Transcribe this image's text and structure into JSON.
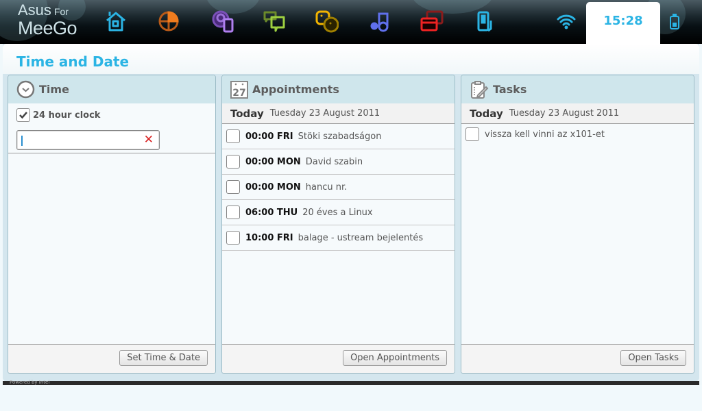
{
  "topbar": {
    "logo_line1": "Asus",
    "logo_line1_small": "For",
    "logo_line2": "MeeGo",
    "apps": [
      {
        "name": "home",
        "color": "#2bb4e4"
      },
      {
        "name": "applications",
        "color": "#e07020"
      },
      {
        "name": "people",
        "color": "#9060d0"
      },
      {
        "name": "status",
        "color": "#8cc63f"
      },
      {
        "name": "friends",
        "color": "#f0b400"
      },
      {
        "name": "media",
        "color": "#5a6ee8"
      },
      {
        "name": "windows",
        "color": "#e02020"
      },
      {
        "name": "device",
        "color": "#2bb4e4"
      }
    ],
    "clock": "15:28",
    "wifi_icon": "wifi-icon",
    "battery_icon": "battery-icon"
  },
  "page": {
    "title": "Time and Date"
  },
  "time_panel": {
    "title": "Time",
    "checkbox_label": "24 hour clock",
    "checkbox_checked": true,
    "input_value": "",
    "button": "Set Time & Date"
  },
  "appointments_panel": {
    "title": "Appointments",
    "calendar_icon_day": "27",
    "today_label": "Today",
    "date": "Tuesday 23 August 2011",
    "items": [
      {
        "time": "00:00 FRI",
        "text": "Stöki szabadságon"
      },
      {
        "time": "00:00 MON",
        "text": "David szabin"
      },
      {
        "time": "00:00 MON",
        "text": "hancu nr."
      },
      {
        "time": "06:00 THU",
        "text": "20 éves a Linux"
      },
      {
        "time": "10:00 FRI",
        "text": "balage - ustream bejelentés"
      }
    ],
    "button": "Open Appointments"
  },
  "tasks_panel": {
    "title": "Tasks",
    "today_label": "Today",
    "date": "Tuesday 23 August 2011",
    "items": [
      {
        "text": "vissza kell vinni az x101-et"
      }
    ],
    "button": "Open Tasks"
  },
  "footer": {
    "powered_by": "Powered by Intel"
  }
}
